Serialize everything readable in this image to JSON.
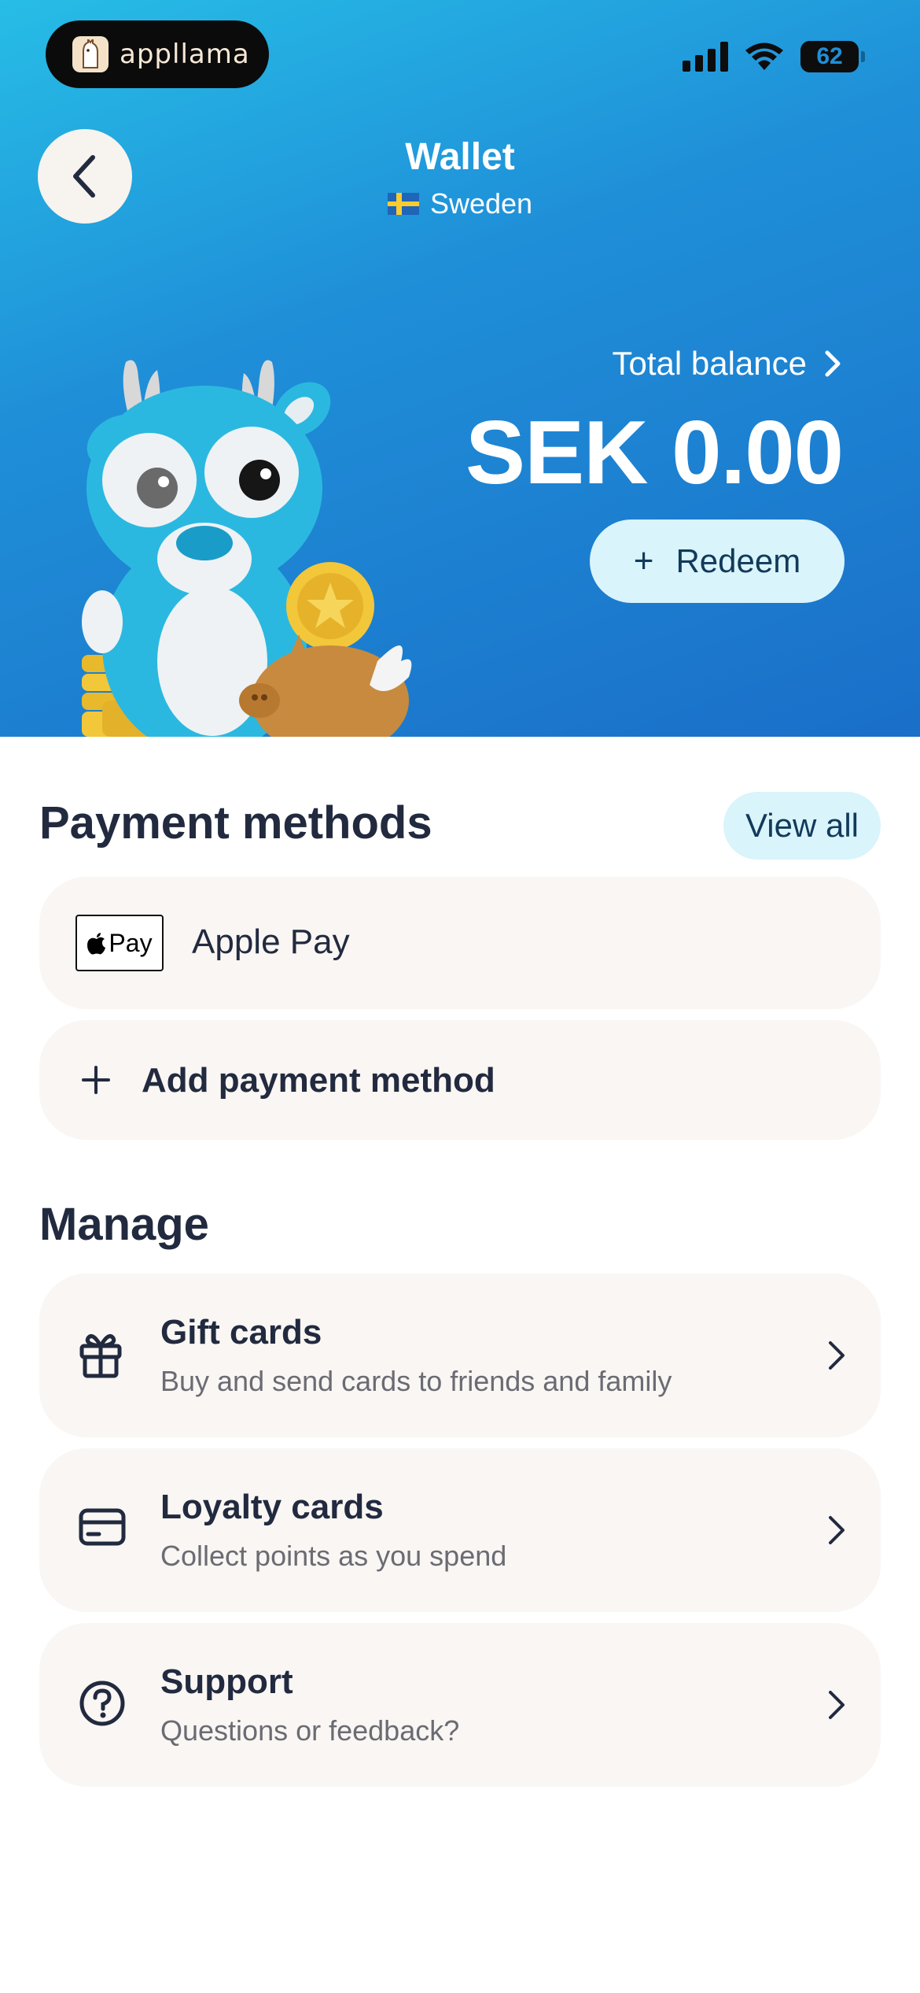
{
  "status_bar": {
    "app_badge": "appllama",
    "battery": "62",
    "battery_fraction": 0.62
  },
  "header": {
    "title": "Wallet",
    "country": "Sweden"
  },
  "balance": {
    "label": "Total balance",
    "amount": "SEK 0.00",
    "redeem_label": "Redeem"
  },
  "payment_methods": {
    "title": "Payment methods",
    "view_all": "View all",
    "items": [
      {
        "logo_text": "Pay",
        "label": "Apple Pay"
      }
    ],
    "add_label": "Add payment method"
  },
  "manage": {
    "title": "Manage",
    "items": [
      {
        "icon": "gift-icon",
        "title": "Gift cards",
        "subtitle": "Buy and send cards to friends and family"
      },
      {
        "icon": "credit-card-icon",
        "title": "Loyalty cards",
        "subtitle": "Collect points as you spend"
      },
      {
        "icon": "question-circle-icon",
        "title": "Support",
        "subtitle": "Questions or feedback?"
      }
    ]
  },
  "colors": {
    "hero_gradient_start": "#27bde6",
    "hero_gradient_end": "#1a6fc8",
    "accent_button_bg": "#d9f4fb",
    "card_bg": "#f9f6f3",
    "text_primary": "#222a3f",
    "text_secondary": "#6b6b73"
  }
}
